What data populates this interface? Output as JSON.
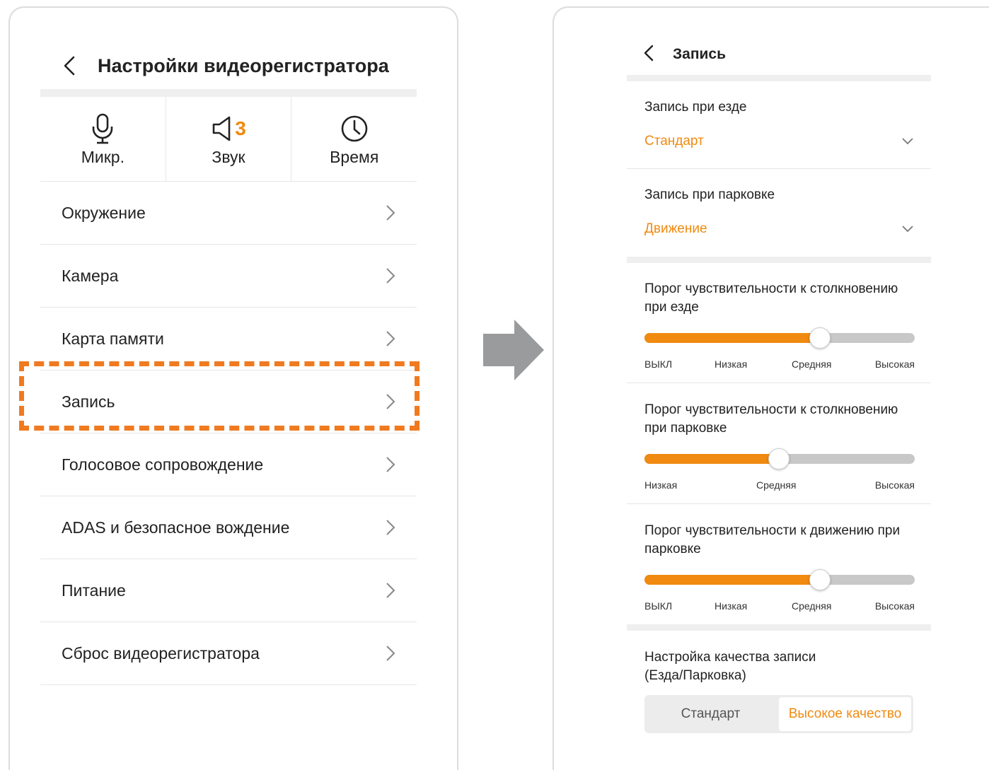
{
  "left_screen": {
    "title": "Настройки видеорегистратора",
    "quick": [
      {
        "label": "Микр.",
        "icon": "microphone-icon"
      },
      {
        "label": "Звук",
        "icon": "speaker-icon",
        "badge": "3"
      },
      {
        "label": "Время",
        "icon": "clock-icon"
      }
    ],
    "menu": [
      {
        "label": "Окружение"
      },
      {
        "label": "Камера"
      },
      {
        "label": "Карта памяти"
      },
      {
        "label": "Запись",
        "highlighted": true
      },
      {
        "label": "Голосовое сопровождение"
      },
      {
        "label": "ADAS и безопасное вождение"
      },
      {
        "label": "Питание"
      },
      {
        "label": "Сброс видеорегистратора"
      }
    ]
  },
  "right_screen": {
    "title": "Запись",
    "drive_record": {
      "label": "Запись при езде",
      "value": "Стандарт"
    },
    "park_record": {
      "label": "Запись при парковке",
      "value": "Движение"
    },
    "sliders": [
      {
        "title_line1": "Порог чувствительности к столкновению",
        "title_line2": "при езде",
        "ticks": [
          "ВЫКЛ",
          "Низкая",
          "Средняя",
          "Высокая"
        ],
        "value": "Средняя"
      },
      {
        "title_line1": "Порог чувствительности к столкновению",
        "title_line2": "при парковке",
        "ticks": [
          "Низкая",
          "Средняя",
          "Высокая"
        ],
        "value": "Средняя"
      },
      {
        "title_line1": "Порог чувствительности к движению при",
        "title_line2": "парковке",
        "ticks": [
          "ВЫКЛ",
          "Низкая",
          "Средняя",
          "Высокая"
        ],
        "value": "Средняя"
      }
    ],
    "quality": {
      "title_line1": "Настройка качества записи",
      "title_line2": "(Езда/Парковка)",
      "options": [
        "Стандарт",
        "Высокое качество"
      ],
      "selected": "Высокое качество"
    }
  },
  "colors": {
    "accent": "#f08a10",
    "highlight_border": "#f07a20",
    "arrow": "#9a9b9c"
  }
}
